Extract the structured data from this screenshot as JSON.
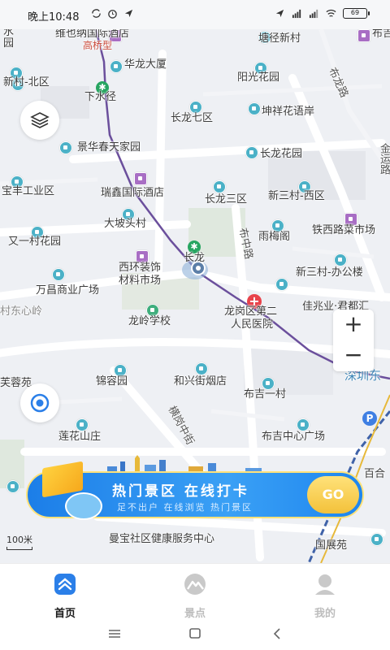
{
  "status_bar": {
    "time": "晚上10:48",
    "battery": "69"
  },
  "map": {
    "labels": [
      {
        "text": "水",
        "cls": ""
      },
      {
        "text": "园",
        "cls": ""
      },
      {
        "text": "维也纳国际酒店",
        "cls": ""
      },
      {
        "text": "高桥型",
        "cls": "metro"
      },
      {
        "text": "塘径新村",
        "cls": ""
      },
      {
        "text": "布吉",
        "cls": ""
      },
      {
        "text": "华龙大厦",
        "cls": ""
      },
      {
        "text": "新村-北区",
        "cls": ""
      },
      {
        "text": "阳光花园",
        "cls": ""
      },
      {
        "text": "布龙路",
        "cls": "road"
      },
      {
        "text": "下水径",
        "cls": ""
      },
      {
        "text": "坤祥花语岸",
        "cls": ""
      },
      {
        "text": "长龙七区",
        "cls": ""
      },
      {
        "text": "景华春天家园",
        "cls": ""
      },
      {
        "text": "长龙花园",
        "cls": ""
      },
      {
        "text": "金运路",
        "cls": "road"
      },
      {
        "text": "宝丰工业区",
        "cls": ""
      },
      {
        "text": "瑞鑫国际酒店",
        "cls": ""
      },
      {
        "text": "长龙三区",
        "cls": ""
      },
      {
        "text": "新三村-西区",
        "cls": ""
      },
      {
        "text": "大坡头村",
        "cls": ""
      },
      {
        "text": "布中路",
        "cls": "road"
      },
      {
        "text": "雨梅阁",
        "cls": ""
      },
      {
        "text": "铁西路菜市场",
        "cls": ""
      },
      {
        "text": "又一村花园",
        "cls": ""
      },
      {
        "text": "长龙",
        "cls": ""
      },
      {
        "text": "西环装饰",
        "cls": ""
      },
      {
        "text": "材料市场",
        "cls": ""
      },
      {
        "text": "新三村-办公楼",
        "cls": ""
      },
      {
        "text": "万昌商业广场",
        "cls": ""
      },
      {
        "text": "村东心岭",
        "cls": ""
      },
      {
        "text": "龙岗区第二",
        "cls": ""
      },
      {
        "text": "人民医院",
        "cls": ""
      },
      {
        "text": "佳兆业·君都汇",
        "cls": ""
      },
      {
        "text": "龙岭学校",
        "cls": ""
      },
      {
        "text": "深圳东",
        "cls": "blue"
      },
      {
        "text": "芙蓉苑",
        "cls": ""
      },
      {
        "text": "锦容园",
        "cls": ""
      },
      {
        "text": "和兴街烟店",
        "cls": ""
      },
      {
        "text": "布吉一村",
        "cls": ""
      },
      {
        "text": "横岗中街",
        "cls": "road"
      },
      {
        "text": "莲花山庄",
        "cls": ""
      },
      {
        "text": "布吉中心广场",
        "cls": ""
      },
      {
        "text": "百合",
        "cls": ""
      },
      {
        "text": "曼宝社区健康服务中心",
        "cls": ""
      },
      {
        "text": "国展苑",
        "cls": ""
      }
    ],
    "scale": "100米",
    "zoom_in": "+",
    "zoom_out": "−"
  },
  "banner": {
    "title": "热门景区  在线打卡",
    "subtitle": "足不出户 在线浏览 热门景区",
    "go": "GO"
  },
  "tabs": [
    {
      "label": "首页",
      "active": true,
      "color": "#1a1a1a"
    },
    {
      "label": "景点",
      "active": false,
      "color": "#bdbdbd"
    },
    {
      "label": "我的",
      "active": false,
      "color": "#bdbdbd"
    }
  ],
  "colors": {
    "accent": "#2b7fe8",
    "metro_line": "#6b4f9c",
    "rail_line": "#3f62a8",
    "hospital": "#e8424a"
  }
}
